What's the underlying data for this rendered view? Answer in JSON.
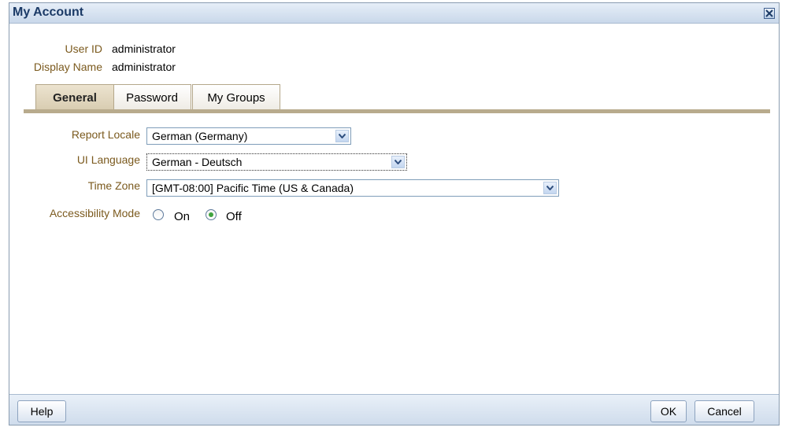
{
  "dialog": {
    "title": "My Account",
    "close_icon": "close-icon"
  },
  "user_info": {
    "user_id_label": "User ID",
    "user_id_value": "administrator",
    "display_name_label": "Display Name",
    "display_name_value": "administrator"
  },
  "tabs": [
    {
      "label": "General",
      "active": true
    },
    {
      "label": "Password",
      "active": false
    },
    {
      "label": "My Groups",
      "active": false
    }
  ],
  "form": {
    "report_locale": {
      "label": "Report Locale",
      "value": "German (Germany)"
    },
    "ui_language": {
      "label": "UI Language",
      "value": "German - Deutsch"
    },
    "time_zone": {
      "label": "Time Zone",
      "value": "[GMT-08:00] Pacific Time (US & Canada)"
    },
    "accessibility_mode": {
      "label": "Accessibility Mode",
      "options": [
        {
          "label": "On",
          "selected": false
        },
        {
          "label": "Off",
          "selected": true
        }
      ]
    }
  },
  "footer": {
    "help_label": "Help",
    "ok_label": "OK",
    "cancel_label": "Cancel"
  },
  "colors": {
    "label_color": "#7b5a1e",
    "tab_bar": "#b8ab8d",
    "title_color": "#1b3a66"
  }
}
